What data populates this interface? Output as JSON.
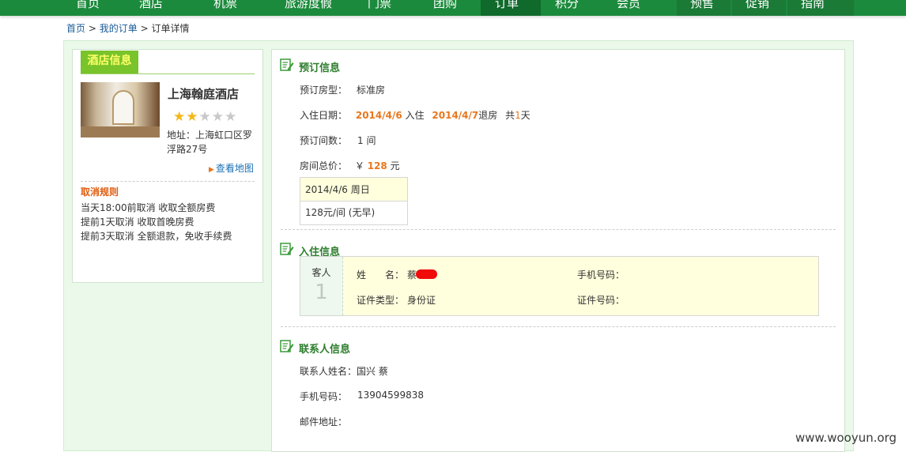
{
  "nav": {
    "items": [
      "首页",
      "酒店",
      "机票",
      "旅游度假",
      "门票",
      "团购",
      "订单",
      "积分",
      "会员",
      "预售",
      "促销",
      "指南"
    ]
  },
  "breadcrumb": {
    "home": "首页",
    "sep1": ">",
    "orders": "我的订单",
    "sep2": ">",
    "current": "订单详情"
  },
  "hotel": {
    "tab_label": "酒店信息",
    "name": "上海翰庭酒店",
    "stars": 2,
    "max_stars": 5,
    "address": "地址：上海虹口区罗浮路27号",
    "map_link": "查看地图",
    "cancel_title": "取消规则",
    "cancel_rules": [
      "当天18:00前取消 收取全额房费",
      "提前1天取消 收取首晚房费",
      "提前3天取消 全额退款，免收手续费"
    ]
  },
  "booking": {
    "title": "预订信息",
    "room_type_label": "预订房型：",
    "room_type": "标准房",
    "dates_label": "入住日期：",
    "checkin_date": "2014/4/6",
    "checkin_word": "入住",
    "checkout_date": "2014/4/7",
    "checkout_word": "退房",
    "total_days_prefix": "共",
    "total_days": "1",
    "total_days_suffix": "天",
    "rooms_label": "预订间数：",
    "rooms": "1 间",
    "price_label": "房间总价：",
    "currency": "￥",
    "price": "128",
    "price_unit": "元",
    "daily": [
      {
        "date": "2014/4/6 周日",
        "rate": "128元/间 (无早)"
      }
    ]
  },
  "checkin_info": {
    "title": "入住信息",
    "guest_caption": "客人",
    "guest_number": "1",
    "name_label": "姓　　名：",
    "name_value": "蔡",
    "phone_label": "手机号码：",
    "phone_value": "",
    "id_type_label": "证件类型：",
    "id_type_value": "身份证",
    "id_number_label": "证件号码：",
    "id_number_value": ""
  },
  "contact": {
    "title": "联系人信息",
    "name_label": "联系人姓名：",
    "name_value": "国兴 蔡",
    "phone_label": "手机号码：",
    "phone_value": "13904599838",
    "email_label": "邮件地址：",
    "email_value": ""
  },
  "watermark": "www.wooyun.org",
  "colors": {
    "nav_green": "#1c8a3c",
    "panel_bg": "#eaf9ea",
    "accent_orange": "#e8771e",
    "section_title": "#2c7d2c",
    "highlight_bg": "#ffffdd"
  }
}
